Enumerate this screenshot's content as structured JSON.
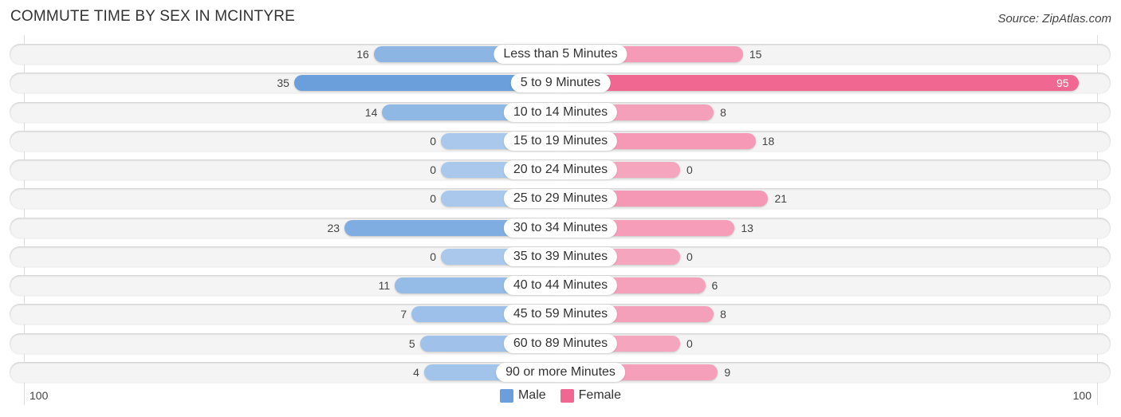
{
  "title": "COMMUTE TIME BY SEX IN MCINTYRE",
  "source": "Source: ZipAtlas.com",
  "colors": {
    "male": "#6a9fdb",
    "male_light": "#a9c8ec",
    "female": "#f06892",
    "female_light": "#f6a5bf"
  },
  "chart_data": {
    "type": "bar",
    "orientation": "horizontal-diverging",
    "title": "COMMUTE TIME BY SEX IN MCINTYRE",
    "categories": [
      "Less than 5 Minutes",
      "5 to 9 Minutes",
      "10 to 14 Minutes",
      "15 to 19 Minutes",
      "20 to 24 Minutes",
      "25 to 29 Minutes",
      "30 to 34 Minutes",
      "35 to 39 Minutes",
      "40 to 44 Minutes",
      "45 to 59 Minutes",
      "60 to 89 Minutes",
      "90 or more Minutes"
    ],
    "series": [
      {
        "name": "Male",
        "values": [
          16,
          35,
          14,
          0,
          0,
          0,
          23,
          0,
          11,
          7,
          5,
          4
        ]
      },
      {
        "name": "Female",
        "values": [
          15,
          95,
          8,
          18,
          0,
          21,
          13,
          0,
          6,
          8,
          0,
          9
        ]
      }
    ],
    "xlim": [
      -100,
      100
    ],
    "tick_labels": {
      "left": "100",
      "right": "100"
    },
    "legend": {
      "position": "bottom-center",
      "entries": [
        "Male",
        "Female"
      ]
    }
  }
}
